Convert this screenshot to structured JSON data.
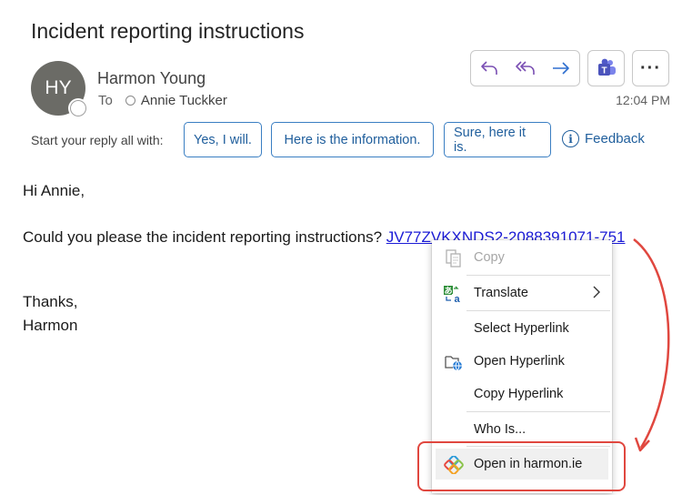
{
  "email": {
    "subject": "Incident reporting instructions",
    "sender": {
      "initials": "HY",
      "name": "Harmon Young"
    },
    "to_label": "To",
    "recipient": "Annie Tuckker",
    "timestamp": "12:04 PM",
    "actions": [
      "reply-icon",
      "reply-all-icon",
      "forward-icon",
      "teams-icon",
      "more-icon"
    ],
    "more_label": "···"
  },
  "suggested_replies": {
    "label": "Start your reply all with:",
    "chips": [
      "Yes, I will.",
      "Here is the information.",
      "Sure, here it is."
    ],
    "feedback": "Feedback"
  },
  "body": {
    "greeting": "Hi Annie,",
    "line_text": "Could you please the incident reporting instructions? ",
    "link_text": "JV77ZVKXNDS2-2088391071-751",
    "closing": "Thanks,",
    "signature": "Harmon"
  },
  "context_menu": {
    "items": [
      {
        "label": "Copy",
        "icon": "copy-icon",
        "disabled": true
      },
      {
        "label": "Translate",
        "icon": "translate-icon",
        "submenu": true
      },
      {
        "label": "Select Hyperlink"
      },
      {
        "label": "Open Hyperlink",
        "icon": "open-hyperlink-icon"
      },
      {
        "label": "Copy Hyperlink"
      },
      {
        "label": "Who Is..."
      },
      {
        "label": "Open in harmon.ie",
        "icon": "harmonie-icon",
        "highlighted": true
      }
    ]
  },
  "colors": {
    "accent": "#1f5e9c",
    "annotation": "#e0473f",
    "link": "#1b1bd6",
    "action_icon": "#7a4fb3"
  }
}
